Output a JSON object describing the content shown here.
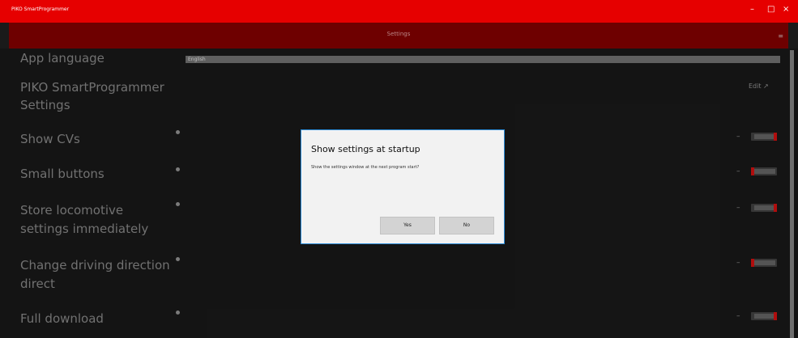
{
  "app": {
    "title": "PIKO SmartProgrammer",
    "minimize_icon": "minimize-icon",
    "maximize_icon": "maximize-icon",
    "close_icon": "close-icon"
  },
  "header": {
    "title": "Settings",
    "menu_icon": "hamburger-menu-icon"
  },
  "settings": {
    "app_language": {
      "label": "App language",
      "value": "English"
    },
    "smartprogrammer": {
      "label_line1": "PIKO SmartProgrammer",
      "label_line2": "Settings",
      "edit_label": "Edit",
      "edit_icon": "external-link-icon"
    },
    "rows": [
      {
        "label_line1": "Show CVs",
        "label_line2": "",
        "toggle": "on"
      },
      {
        "label_line1": "Small buttons",
        "label_line2": "",
        "toggle": "off"
      },
      {
        "label_line1": "Store locomotive",
        "label_line2": "settings immediately",
        "toggle": "on"
      },
      {
        "label_line1": "Change driving direction",
        "label_line2": "direct",
        "toggle": "off"
      },
      {
        "label_line1": "Full download",
        "label_line2": "",
        "toggle": "on"
      }
    ],
    "toggle_dash": "–"
  },
  "dialog": {
    "title": "Show settings at startup",
    "message": "Show the settings window at the next program start?",
    "yes_label": "Yes",
    "no_label": "No"
  },
  "colors": {
    "accent": "#e60000",
    "header": "#6e0000",
    "background": "#1a1a1a",
    "dialog_border": "#2a8ad6"
  }
}
